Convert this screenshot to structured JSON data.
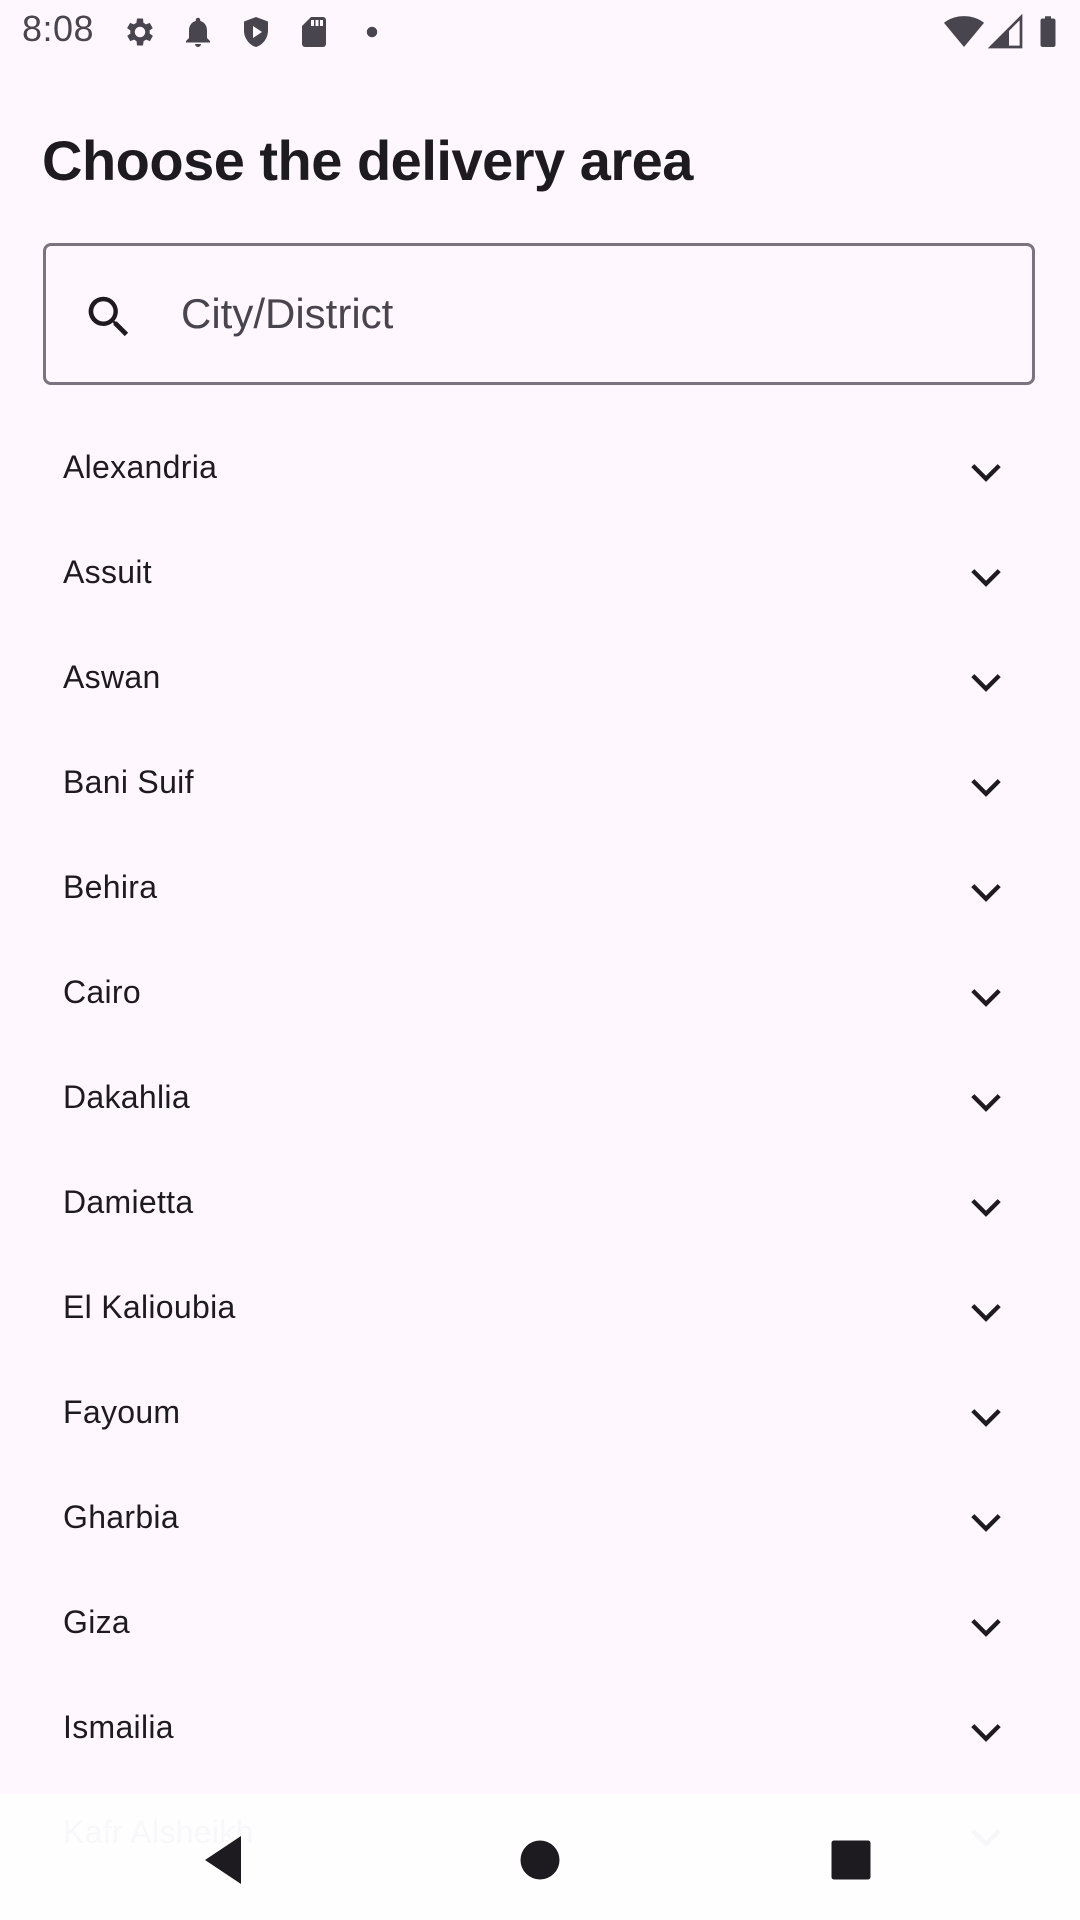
{
  "status_bar": {
    "time": "8:08",
    "left_icons": [
      "gear-icon",
      "bell-icon",
      "shield-icon",
      "sd-card-icon",
      "dot-icon"
    ],
    "right_icons": [
      "wifi-icon",
      "cell-signal-icon",
      "battery-icon"
    ]
  },
  "title": "Choose the delivery area",
  "search": {
    "placeholder": "City/District",
    "value": "",
    "icon": "search-icon"
  },
  "areas": [
    "Alexandria",
    "Assuit",
    "Aswan",
    "Bani Suif",
    "Behira",
    "Cairo",
    "Dakahlia",
    "Damietta",
    "El Kalioubia",
    "Fayoum",
    "Gharbia",
    "Giza",
    "Ismailia",
    "Kafr Alsheikh"
  ],
  "item_icon": "chevron-down-icon",
  "nav_bar": {
    "buttons": [
      "back-icon",
      "home-icon",
      "recents-icon"
    ]
  },
  "colors": {
    "background": "#fef7fe",
    "text": "#1d1b20",
    "outline": "#79747e",
    "secondary_text": "#49454f"
  }
}
